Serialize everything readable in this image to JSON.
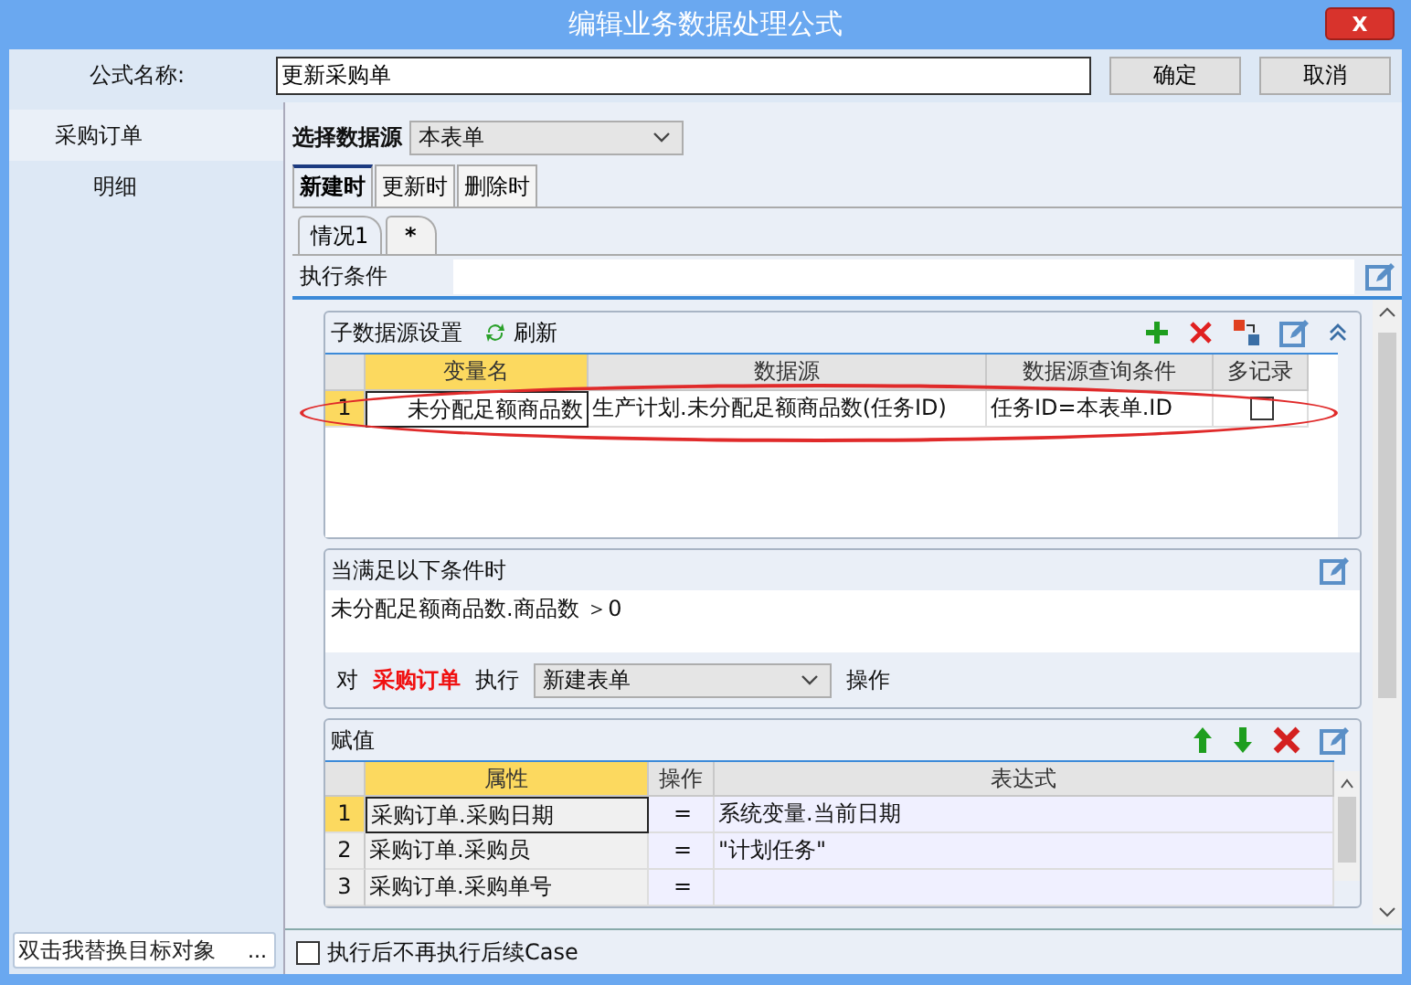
{
  "window": {
    "title": "编辑业务数据处理公式",
    "close": "X"
  },
  "formula_name": {
    "label": "公式名称:",
    "value": "更新采购单"
  },
  "buttons": [
    "确定",
    "取消"
  ],
  "sidebar": {
    "items": [
      {
        "label": "采购订单",
        "selected": true
      },
      {
        "label": "明细",
        "selected": false
      }
    ],
    "target_field": {
      "placeholder": "双击我替换目标对象",
      "button": "..."
    }
  },
  "data_source": {
    "label": "选择数据源",
    "value": "本表单"
  },
  "tabs": [
    {
      "label": "新建时",
      "selected": true
    },
    {
      "label": "更新时",
      "selected": false
    },
    {
      "label": "删除时",
      "selected": false
    }
  ],
  "case_tabs": [
    {
      "label": "情况1",
      "selected": true
    },
    {
      "label": "*",
      "selected": false
    }
  ],
  "exec_condition": {
    "label": "执行条件"
  },
  "sub_data_source": {
    "title": "子数据源设置",
    "refresh": "刷新",
    "columns": [
      "变量名",
      "数据源",
      "数据源查询条件",
      "多记录"
    ],
    "rows": [
      {
        "number": "1",
        "variable": "未分配足额商品数",
        "source": "生产计划.未分配足额商品数(任务ID)",
        "query": "任务ID=本表单.ID",
        "multi": false,
        "highlighted": true
      }
    ]
  },
  "when": {
    "title": "当满足以下条件时",
    "condition": "未分配足额商品数.商品数  ＞0",
    "prefix": "对",
    "target": "采购订单",
    "verb": "执行",
    "action": "新建表单",
    "suffix": "操作"
  },
  "assignment": {
    "title": "赋值",
    "columns": [
      "属性",
      "操作",
      "表达式"
    ],
    "rows": [
      {
        "number": "1",
        "property": "采购订单.采购日期",
        "op": "=",
        "expression": "系统变量.当前日期",
        "selected": true
      },
      {
        "number": "2",
        "property": "采购订单.采购员",
        "op": "=",
        "expression": "\"计划任务\"",
        "selected": false
      },
      {
        "number": "3",
        "property": "采购订单.采购单号",
        "op": "=",
        "expression": "",
        "selected": false
      }
    ]
  },
  "stop_after": {
    "label": "执行后不再执行后续Case",
    "checked": false
  }
}
